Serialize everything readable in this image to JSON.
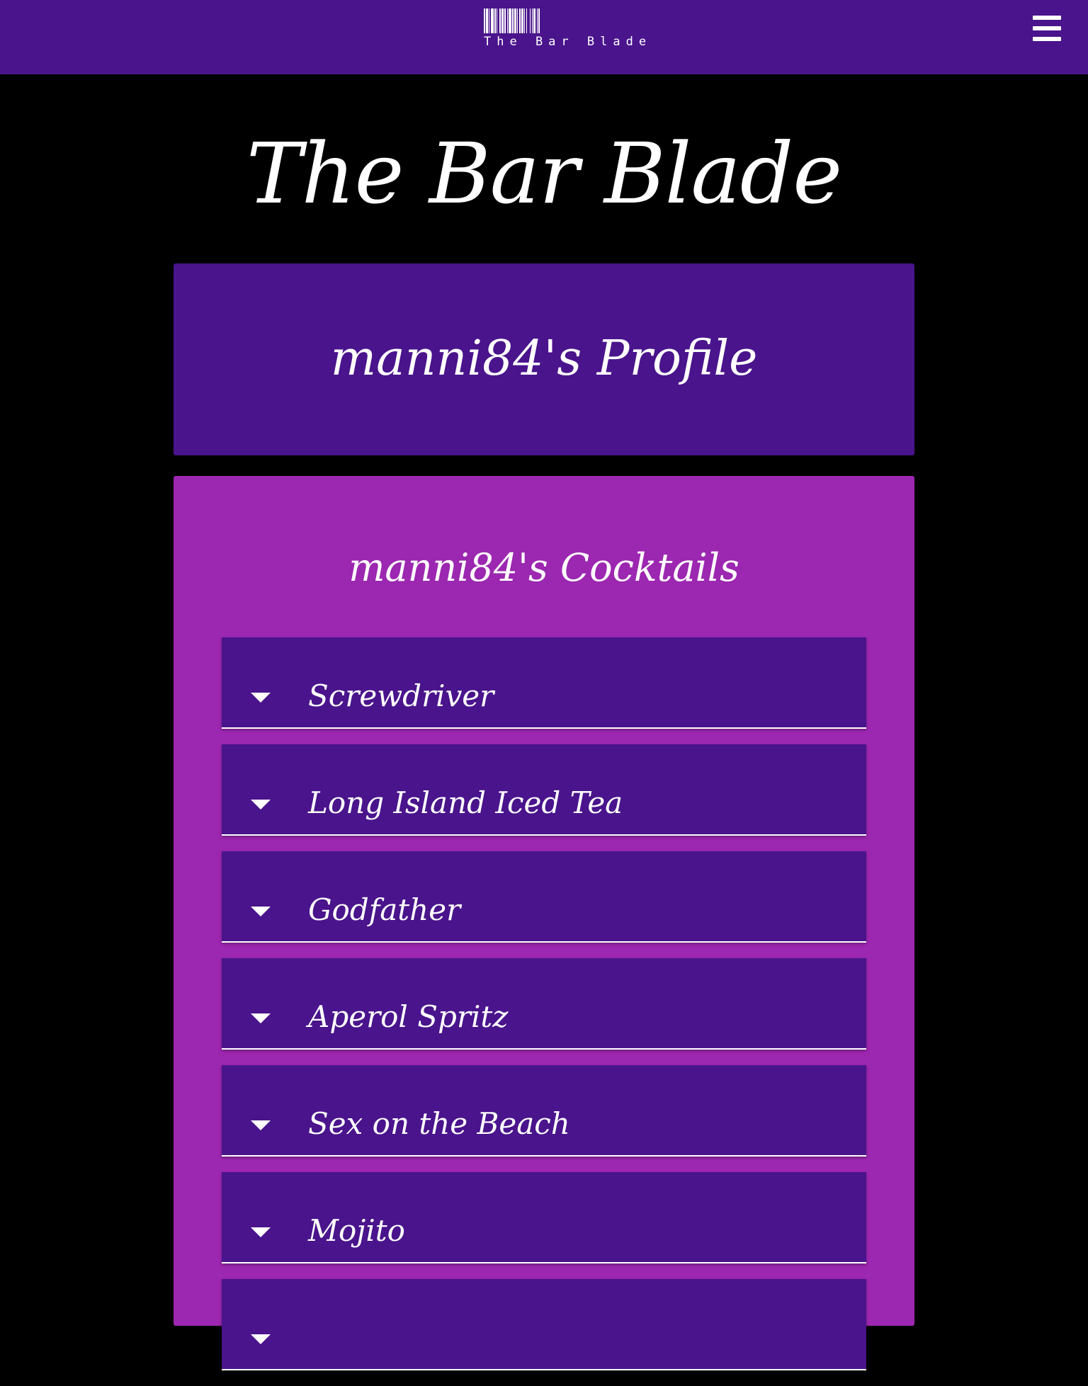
{
  "navbar": {
    "logo_text": "The Bar Blade",
    "menu_icon": "hamburger-menu-icon",
    "background": "#4a148c"
  },
  "site_title": "The Bar Blade",
  "profile": {
    "title": "manni84's Profile"
  },
  "cocktails": {
    "title": "manni84's Cocktails",
    "items": [
      {
        "name": "Screwdriver",
        "icon": "caret-down-icon"
      },
      {
        "name": "Long Island Iced Tea",
        "icon": "caret-down-icon"
      },
      {
        "name": "Godfather",
        "icon": "caret-down-icon"
      },
      {
        "name": "Aperol Spritz",
        "icon": "caret-down-icon"
      },
      {
        "name": "Sex on the Beach",
        "icon": "caret-down-icon"
      },
      {
        "name": "Mojito",
        "icon": "caret-down-icon"
      },
      {
        "name": "",
        "icon": "caret-down-icon"
      }
    ]
  },
  "colors": {
    "primary": "#4a148c",
    "accent": "#9c27b0",
    "page_background": "#000000",
    "text": "#ffffff"
  }
}
